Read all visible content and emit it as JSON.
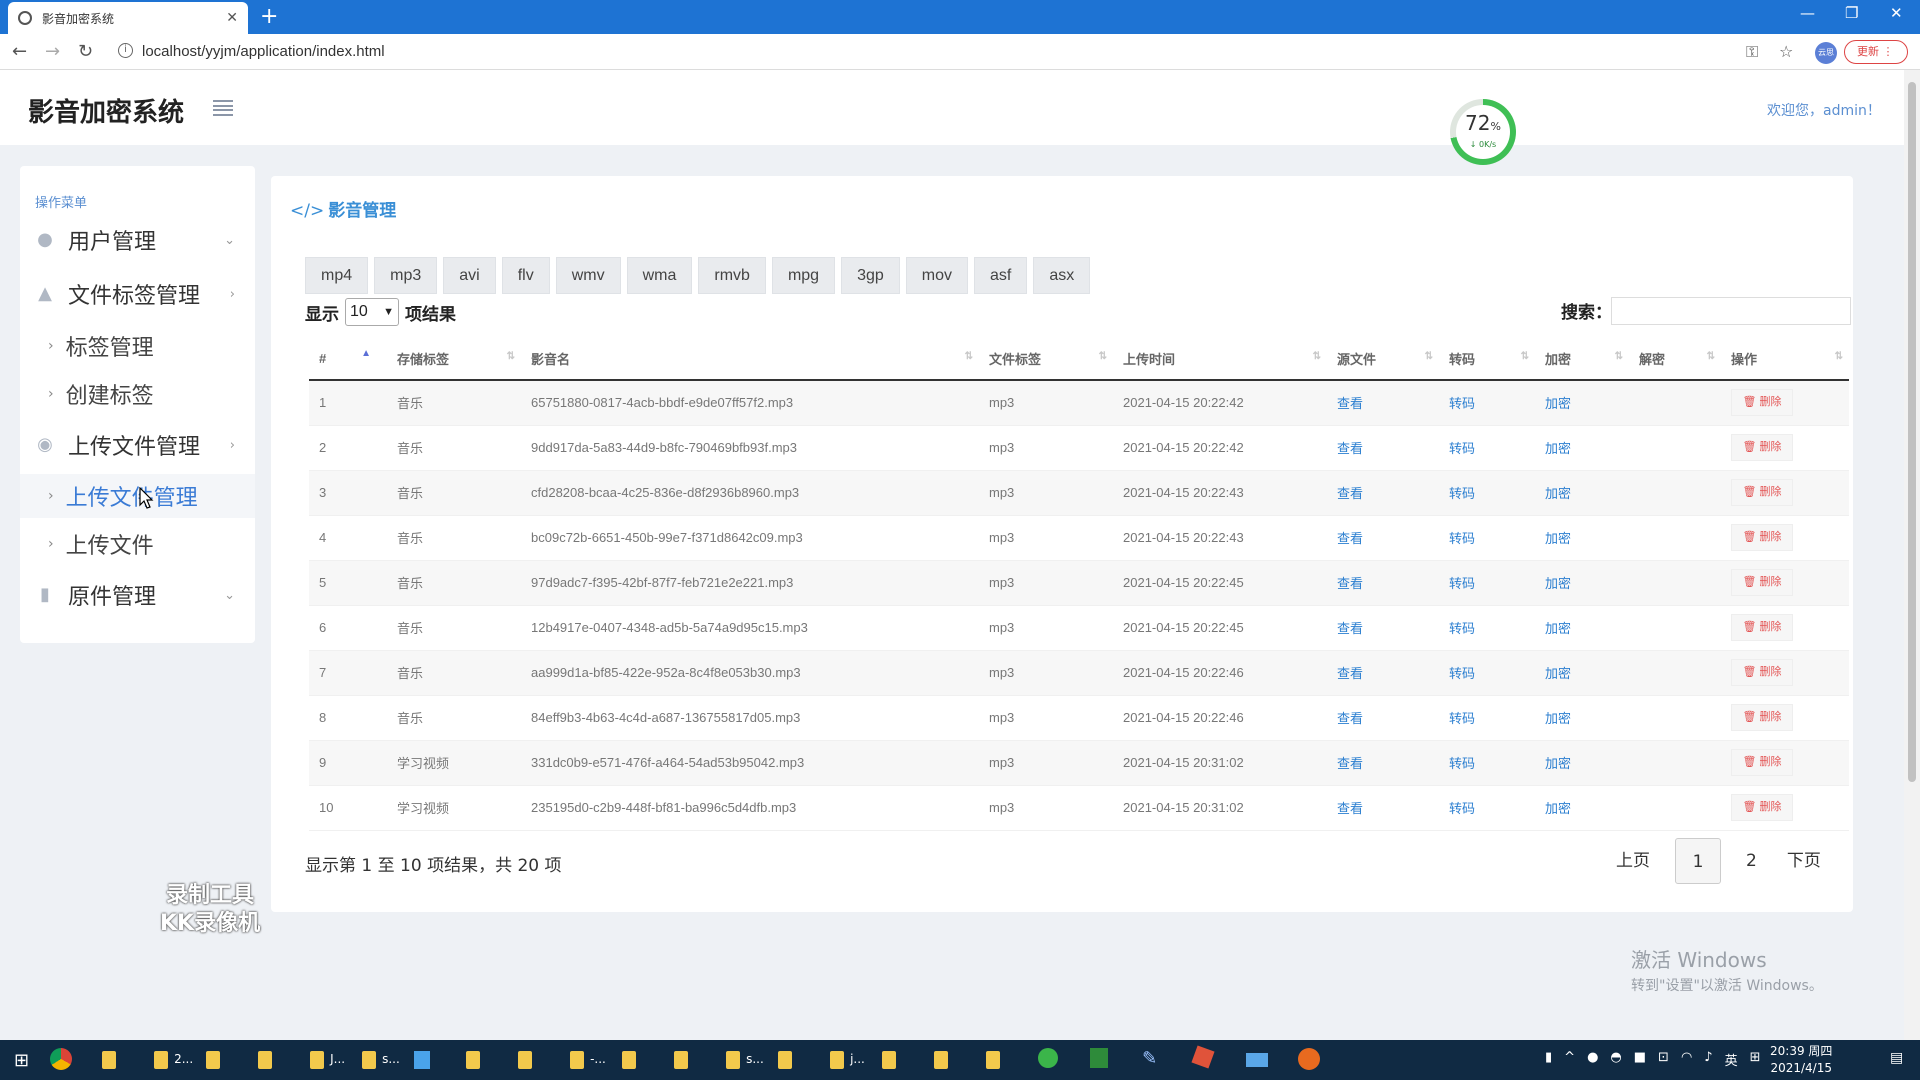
{
  "browser": {
    "tab_title": "影音加密系统",
    "url": "localhost/yyjm/application/index.html",
    "update_label": "更新",
    "profile_text": "云思"
  },
  "header": {
    "brand": "影音加密系统",
    "welcome": "欢迎您，admin！"
  },
  "net_widget": {
    "percent": "72",
    "percent_sign": "%",
    "speed": "0K/s"
  },
  "sidebar": {
    "title": "操作菜单",
    "items": [
      {
        "label": "用户管理"
      },
      {
        "label": "文件标签管理"
      },
      {
        "label": "标签管理"
      },
      {
        "label": "创建标签"
      },
      {
        "label": "上传文件管理"
      },
      {
        "label": "上传文件管理"
      },
      {
        "label": "上传文件"
      },
      {
        "label": "原件管理"
      }
    ]
  },
  "panel": {
    "title": "影音管理",
    "formats": [
      "mp4",
      "mp3",
      "avi",
      "flv",
      "wmv",
      "wma",
      "rmvb",
      "mpg",
      "3gp",
      "mov",
      "asf",
      "asx"
    ],
    "show_prefix": "显示",
    "page_size": "10",
    "show_suffix": "项结果",
    "search_label": "搜索：",
    "columns": [
      "#",
      "存储标签",
      "影音名",
      "文件标签",
      "上传时间",
      "源文件",
      "转码",
      "加密",
      "解密",
      "操作"
    ],
    "rows": [
      {
        "no": "1",
        "tag": "音乐",
        "name": "65751880-0817-4acb-bbdf-e9de07ff57f2.mp3",
        "ftag": "mp3",
        "time": "2021-04-15 20:22:42",
        "view": "查看",
        "transcode": "转码",
        "encrypt": "加密",
        "decrypt": "",
        "del": "删除"
      },
      {
        "no": "2",
        "tag": "音乐",
        "name": "9dd917da-5a83-44d9-b8fc-790469bfb93f.mp3",
        "ftag": "mp3",
        "time": "2021-04-15 20:22:42",
        "view": "查看",
        "transcode": "转码",
        "encrypt": "加密",
        "decrypt": "",
        "del": "删除"
      },
      {
        "no": "3",
        "tag": "音乐",
        "name": "cfd28208-bcaa-4c25-836e-d8f2936b8960.mp3",
        "ftag": "mp3",
        "time": "2021-04-15 20:22:43",
        "view": "查看",
        "transcode": "转码",
        "encrypt": "加密",
        "decrypt": "",
        "del": "删除"
      },
      {
        "no": "4",
        "tag": "音乐",
        "name": "bc09c72b-6651-450b-99e7-f371d8642c09.mp3",
        "ftag": "mp3",
        "time": "2021-04-15 20:22:43",
        "view": "查看",
        "transcode": "转码",
        "encrypt": "加密",
        "decrypt": "",
        "del": "删除"
      },
      {
        "no": "5",
        "tag": "音乐",
        "name": "97d9adc7-f395-42bf-87f7-feb721e2e221.mp3",
        "ftag": "mp3",
        "time": "2021-04-15 20:22:45",
        "view": "查看",
        "transcode": "转码",
        "encrypt": "加密",
        "decrypt": "",
        "del": "删除"
      },
      {
        "no": "6",
        "tag": "音乐",
        "name": "12b4917e-0407-4348-ad5b-5a74a9d95c15.mp3",
        "ftag": "mp3",
        "time": "2021-04-15 20:22:45",
        "view": "查看",
        "transcode": "转码",
        "encrypt": "加密",
        "decrypt": "",
        "del": "删除"
      },
      {
        "no": "7",
        "tag": "音乐",
        "name": "aa999d1a-bf85-422e-952a-8c4f8e053b30.mp3",
        "ftag": "mp3",
        "time": "2021-04-15 20:22:46",
        "view": "查看",
        "transcode": "转码",
        "encrypt": "加密",
        "decrypt": "",
        "del": "删除"
      },
      {
        "no": "8",
        "tag": "音乐",
        "name": "84eff9b3-4b63-4c4d-a687-136755817d05.mp3",
        "ftag": "mp3",
        "time": "2021-04-15 20:22:46",
        "view": "查看",
        "transcode": "转码",
        "encrypt": "加密",
        "decrypt": "",
        "del": "删除"
      },
      {
        "no": "9",
        "tag": "学习视频",
        "name": "331dc0b9-e571-476f-a464-54ad53b95042.mp3",
        "ftag": "mp3",
        "time": "2021-04-15 20:31:02",
        "view": "查看",
        "transcode": "转码",
        "encrypt": "加密",
        "decrypt": "",
        "del": "删除"
      },
      {
        "no": "10",
        "tag": "学习视频",
        "name": "235195d0-c2b9-448f-bf81-ba996c5d4dfb.mp3",
        "ftag": "mp3",
        "time": "2021-04-15 20:31:02",
        "view": "查看",
        "transcode": "转码",
        "encrypt": "加密",
        "decrypt": "",
        "del": "删除"
      }
    ],
    "info": "显示第 1 至 10 项结果，共 20 项",
    "pager": {
      "prev": "上页",
      "pages": [
        "1",
        "2"
      ],
      "current": "1",
      "next": "下页"
    }
  },
  "watermark": {
    "line1": "录制工具",
    "line2": "KK录像机"
  },
  "windows_activation": {
    "line1": "激活 Windows",
    "line2": "转到\"设置\"以激活 Windows。"
  },
  "taskbar": {
    "labels": [
      "2...",
      "J...",
      "s...",
      "-...",
      "s...",
      "j..."
    ],
    "ime": "英",
    "time": "20:39 周四",
    "date": "2021/4/15"
  },
  "colors": {
    "accent": "#3a8fd6",
    "titlebar": "#1e73d3",
    "danger": "#e35555",
    "progress": "#3fbf55"
  }
}
